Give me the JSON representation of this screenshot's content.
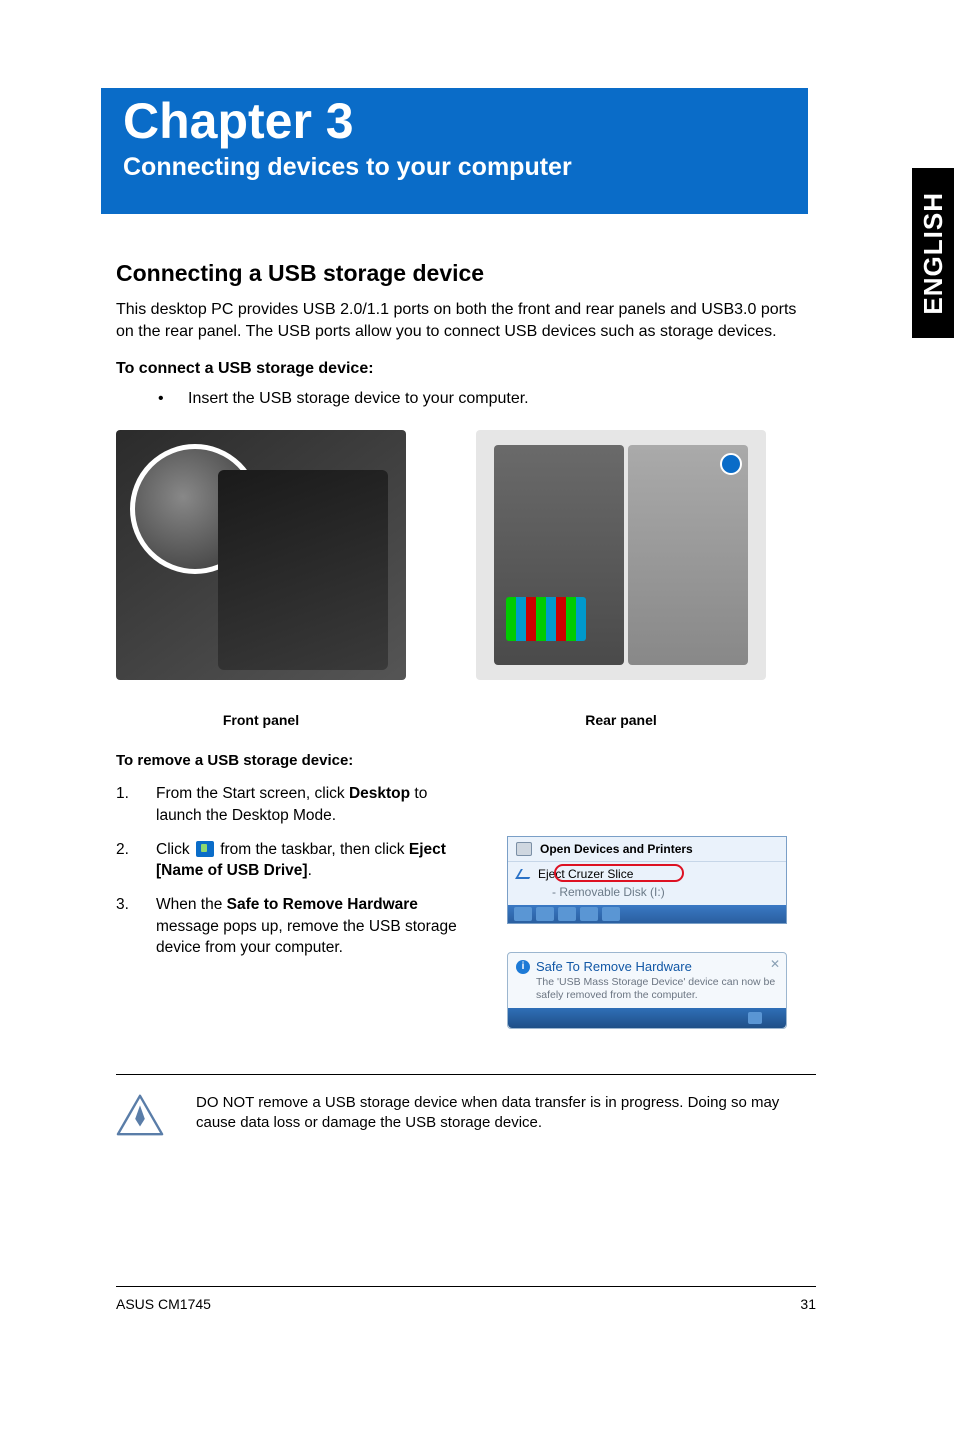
{
  "sideTab": "ENGLISH",
  "chapter": {
    "title": "Chapter 3",
    "subtitle": "Connecting devices to your computer"
  },
  "section": {
    "heading": "Connecting a USB storage device",
    "intro": "This desktop PC provides USB 2.0/1.1 ports on both the front and rear panels and USB3.0 ports on the rear panel. The USB ports allow you to connect USB devices such as storage devices.",
    "connect_head": "To connect a USB storage device:",
    "connect_bullet": "Insert the USB storage device to your computer."
  },
  "figures": {
    "front": "Front panel",
    "rear": "Rear panel"
  },
  "remove": {
    "head": "To remove a USB storage device:",
    "steps": [
      {
        "num": "1.",
        "pre": "From the Start screen, click ",
        "bold": "Desktop",
        "post": " to launch the Desktop Mode."
      },
      {
        "num": "2.",
        "pre": "Click ",
        "mid1": " from the taskbar, then click ",
        "bold": "Eject [Name of USB Drive]",
        "post": "."
      },
      {
        "num": "3.",
        "pre": "When the ",
        "bold": "Safe to Remove Hardware",
        "post": " message pops up, remove the USB storage device from your computer."
      }
    ]
  },
  "popup": {
    "open": "Open Devices and Printers",
    "eject": "Eject Cruzer Slice",
    "removable": "Removable Disk (I:)"
  },
  "balloon": {
    "title": "Safe To Remove Hardware",
    "body": "The 'USB Mass Storage Device' device can now be safely removed from the computer."
  },
  "warning": "DO NOT remove a USB storage device when data transfer is in progress. Doing so may cause data loss or damage the USB storage device.",
  "footer": {
    "left": "ASUS CM1745",
    "right": "31"
  }
}
